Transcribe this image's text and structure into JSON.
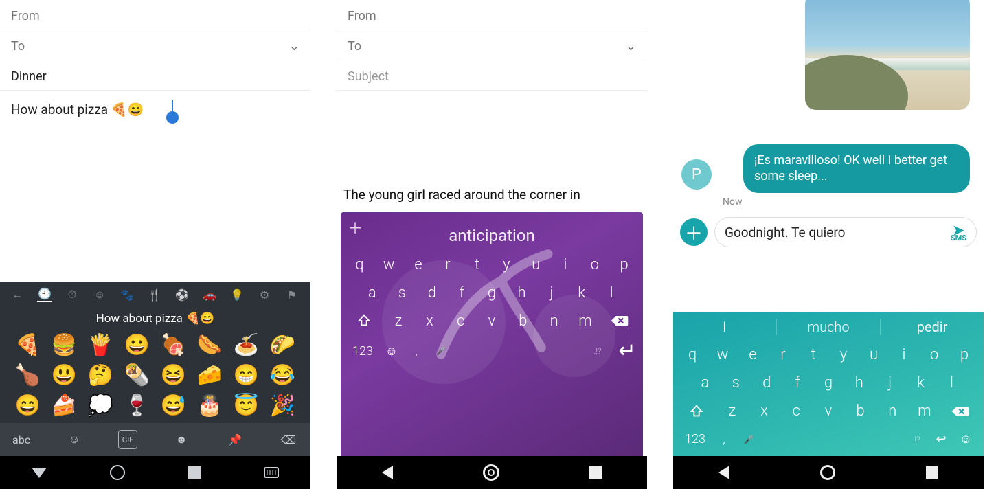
{
  "phone1": {
    "from_label": "From",
    "to_label": "To",
    "subject": "Dinner",
    "body": "How about pizza 🍕😄",
    "suggestion_bar": "How about pizza 🍕😄",
    "categories": [
      "back",
      "recent",
      "smile",
      "clock2",
      "cup",
      "mask",
      "ball",
      "bulb",
      "settings",
      "flag"
    ],
    "emoji_grid": [
      "🍕",
      "🍔",
      "🍟",
      "😀",
      "🍖",
      "🌭",
      "🍝",
      "🌮",
      "🍗",
      "😃",
      "🤔",
      "🌯",
      "😆",
      "🧀",
      "😁",
      "😂",
      "😄",
      "🍰",
      "💭",
      "🍷",
      "😅",
      "🎂",
      "😇",
      "🎉"
    ],
    "bottom_bar": {
      "abc": "abc",
      "emoji": "emoji",
      "gif": "GIF",
      "sticker": "sticker",
      "pin": "pin",
      "back": "back"
    }
  },
  "phone2": {
    "from_label": "From",
    "to_label": "To",
    "subject_placeholder": "Subject",
    "body": "The young girl raced around the corner in",
    "prediction": "anticipation",
    "rows": {
      "r1": [
        "q",
        "w",
        "e",
        "r",
        "t",
        "y",
        "u",
        "i",
        "o",
        "p"
      ],
      "r2": [
        "a",
        "s",
        "d",
        "f",
        "g",
        "h",
        "j",
        "k",
        "l"
      ],
      "r3": [
        "z",
        "x",
        "c",
        "v",
        "b",
        "n",
        "m"
      ]
    },
    "func": {
      "num": "123",
      "comma": ",",
      "mic": "🎤",
      "punct": ".!?",
      "enter": "enter"
    }
  },
  "phone3": {
    "bubble": "¡Es maravilloso! OK well I better get some sleep...",
    "time": "Now",
    "avatar": "P",
    "compose_text": "Goodnight. Te quiero",
    "send_label": "SMS",
    "predictions": [
      "I",
      "mucho",
      "pedir"
    ],
    "rows": {
      "r1": [
        "q",
        "w",
        "e",
        "r",
        "t",
        "y",
        "u",
        "i",
        "o",
        "p"
      ],
      "r2": [
        "a",
        "s",
        "d",
        "f",
        "g",
        "h",
        "j",
        "k",
        "l"
      ],
      "r3": [
        "z",
        "x",
        "c",
        "v",
        "b",
        "n",
        "m"
      ]
    },
    "func": {
      "num": "123",
      "comma": ",",
      "mic": "🎤",
      "punct": ".!?"
    }
  }
}
